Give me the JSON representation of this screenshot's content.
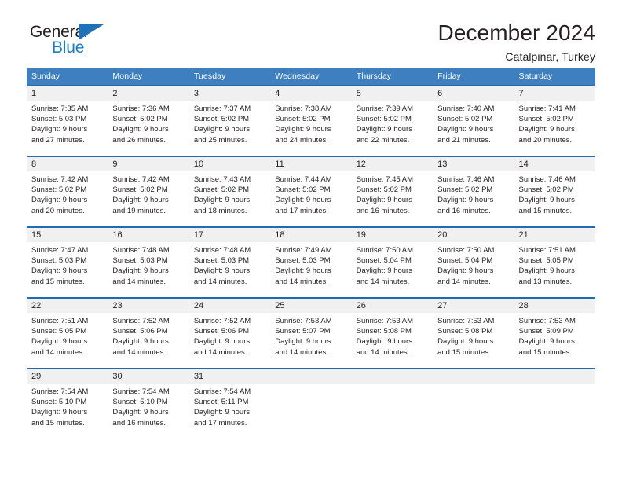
{
  "brand": {
    "line1": "General",
    "line2": "Blue",
    "flag_icon": "triangle-flag-icon",
    "accent_color": "#1f72b8"
  },
  "header": {
    "month_title": "December 2024",
    "location": "Catalpinar, Turkey"
  },
  "calendar": {
    "header_bg": "#3d7fbf",
    "row_divider_color": "#1f6cb4",
    "daynum_bg": "#f0f0f0",
    "weekday_labels": [
      "Sunday",
      "Monday",
      "Tuesday",
      "Wednesday",
      "Thursday",
      "Friday",
      "Saturday"
    ],
    "weeks": [
      [
        {
          "day": "1",
          "sunrise": "Sunrise: 7:35 AM",
          "sunset": "Sunset: 5:03 PM",
          "daylight1": "Daylight: 9 hours",
          "daylight2": "and 27 minutes."
        },
        {
          "day": "2",
          "sunrise": "Sunrise: 7:36 AM",
          "sunset": "Sunset: 5:02 PM",
          "daylight1": "Daylight: 9 hours",
          "daylight2": "and 26 minutes."
        },
        {
          "day": "3",
          "sunrise": "Sunrise: 7:37 AM",
          "sunset": "Sunset: 5:02 PM",
          "daylight1": "Daylight: 9 hours",
          "daylight2": "and 25 minutes."
        },
        {
          "day": "4",
          "sunrise": "Sunrise: 7:38 AM",
          "sunset": "Sunset: 5:02 PM",
          "daylight1": "Daylight: 9 hours",
          "daylight2": "and 24 minutes."
        },
        {
          "day": "5",
          "sunrise": "Sunrise: 7:39 AM",
          "sunset": "Sunset: 5:02 PM",
          "daylight1": "Daylight: 9 hours",
          "daylight2": "and 22 minutes."
        },
        {
          "day": "6",
          "sunrise": "Sunrise: 7:40 AM",
          "sunset": "Sunset: 5:02 PM",
          "daylight1": "Daylight: 9 hours",
          "daylight2": "and 21 minutes."
        },
        {
          "day": "7",
          "sunrise": "Sunrise: 7:41 AM",
          "sunset": "Sunset: 5:02 PM",
          "daylight1": "Daylight: 9 hours",
          "daylight2": "and 20 minutes."
        }
      ],
      [
        {
          "day": "8",
          "sunrise": "Sunrise: 7:42 AM",
          "sunset": "Sunset: 5:02 PM",
          "daylight1": "Daylight: 9 hours",
          "daylight2": "and 20 minutes."
        },
        {
          "day": "9",
          "sunrise": "Sunrise: 7:42 AM",
          "sunset": "Sunset: 5:02 PM",
          "daylight1": "Daylight: 9 hours",
          "daylight2": "and 19 minutes."
        },
        {
          "day": "10",
          "sunrise": "Sunrise: 7:43 AM",
          "sunset": "Sunset: 5:02 PM",
          "daylight1": "Daylight: 9 hours",
          "daylight2": "and 18 minutes."
        },
        {
          "day": "11",
          "sunrise": "Sunrise: 7:44 AM",
          "sunset": "Sunset: 5:02 PM",
          "daylight1": "Daylight: 9 hours",
          "daylight2": "and 17 minutes."
        },
        {
          "day": "12",
          "sunrise": "Sunrise: 7:45 AM",
          "sunset": "Sunset: 5:02 PM",
          "daylight1": "Daylight: 9 hours",
          "daylight2": "and 16 minutes."
        },
        {
          "day": "13",
          "sunrise": "Sunrise: 7:46 AM",
          "sunset": "Sunset: 5:02 PM",
          "daylight1": "Daylight: 9 hours",
          "daylight2": "and 16 minutes."
        },
        {
          "day": "14",
          "sunrise": "Sunrise: 7:46 AM",
          "sunset": "Sunset: 5:02 PM",
          "daylight1": "Daylight: 9 hours",
          "daylight2": "and 15 minutes."
        }
      ],
      [
        {
          "day": "15",
          "sunrise": "Sunrise: 7:47 AM",
          "sunset": "Sunset: 5:03 PM",
          "daylight1": "Daylight: 9 hours",
          "daylight2": "and 15 minutes."
        },
        {
          "day": "16",
          "sunrise": "Sunrise: 7:48 AM",
          "sunset": "Sunset: 5:03 PM",
          "daylight1": "Daylight: 9 hours",
          "daylight2": "and 14 minutes."
        },
        {
          "day": "17",
          "sunrise": "Sunrise: 7:48 AM",
          "sunset": "Sunset: 5:03 PM",
          "daylight1": "Daylight: 9 hours",
          "daylight2": "and 14 minutes."
        },
        {
          "day": "18",
          "sunrise": "Sunrise: 7:49 AM",
          "sunset": "Sunset: 5:03 PM",
          "daylight1": "Daylight: 9 hours",
          "daylight2": "and 14 minutes."
        },
        {
          "day": "19",
          "sunrise": "Sunrise: 7:50 AM",
          "sunset": "Sunset: 5:04 PM",
          "daylight1": "Daylight: 9 hours",
          "daylight2": "and 14 minutes."
        },
        {
          "day": "20",
          "sunrise": "Sunrise: 7:50 AM",
          "sunset": "Sunset: 5:04 PM",
          "daylight1": "Daylight: 9 hours",
          "daylight2": "and 14 minutes."
        },
        {
          "day": "21",
          "sunrise": "Sunrise: 7:51 AM",
          "sunset": "Sunset: 5:05 PM",
          "daylight1": "Daylight: 9 hours",
          "daylight2": "and 13 minutes."
        }
      ],
      [
        {
          "day": "22",
          "sunrise": "Sunrise: 7:51 AM",
          "sunset": "Sunset: 5:05 PM",
          "daylight1": "Daylight: 9 hours",
          "daylight2": "and 14 minutes."
        },
        {
          "day": "23",
          "sunrise": "Sunrise: 7:52 AM",
          "sunset": "Sunset: 5:06 PM",
          "daylight1": "Daylight: 9 hours",
          "daylight2": "and 14 minutes."
        },
        {
          "day": "24",
          "sunrise": "Sunrise: 7:52 AM",
          "sunset": "Sunset: 5:06 PM",
          "daylight1": "Daylight: 9 hours",
          "daylight2": "and 14 minutes."
        },
        {
          "day": "25",
          "sunrise": "Sunrise: 7:53 AM",
          "sunset": "Sunset: 5:07 PM",
          "daylight1": "Daylight: 9 hours",
          "daylight2": "and 14 minutes."
        },
        {
          "day": "26",
          "sunrise": "Sunrise: 7:53 AM",
          "sunset": "Sunset: 5:08 PM",
          "daylight1": "Daylight: 9 hours",
          "daylight2": "and 14 minutes."
        },
        {
          "day": "27",
          "sunrise": "Sunrise: 7:53 AM",
          "sunset": "Sunset: 5:08 PM",
          "daylight1": "Daylight: 9 hours",
          "daylight2": "and 15 minutes."
        },
        {
          "day": "28",
          "sunrise": "Sunrise: 7:53 AM",
          "sunset": "Sunset: 5:09 PM",
          "daylight1": "Daylight: 9 hours",
          "daylight2": "and 15 minutes."
        }
      ],
      [
        {
          "day": "29",
          "sunrise": "Sunrise: 7:54 AM",
          "sunset": "Sunset: 5:10 PM",
          "daylight1": "Daylight: 9 hours",
          "daylight2": "and 15 minutes."
        },
        {
          "day": "30",
          "sunrise": "Sunrise: 7:54 AM",
          "sunset": "Sunset: 5:10 PM",
          "daylight1": "Daylight: 9 hours",
          "daylight2": "and 16 minutes."
        },
        {
          "day": "31",
          "sunrise": "Sunrise: 7:54 AM",
          "sunset": "Sunset: 5:11 PM",
          "daylight1": "Daylight: 9 hours",
          "daylight2": "and 17 minutes."
        },
        {
          "day": "",
          "sunrise": "",
          "sunset": "",
          "daylight1": "",
          "daylight2": ""
        },
        {
          "day": "",
          "sunrise": "",
          "sunset": "",
          "daylight1": "",
          "daylight2": ""
        },
        {
          "day": "",
          "sunrise": "",
          "sunset": "",
          "daylight1": "",
          "daylight2": ""
        },
        {
          "day": "",
          "sunrise": "",
          "sunset": "",
          "daylight1": "",
          "daylight2": ""
        }
      ]
    ]
  }
}
